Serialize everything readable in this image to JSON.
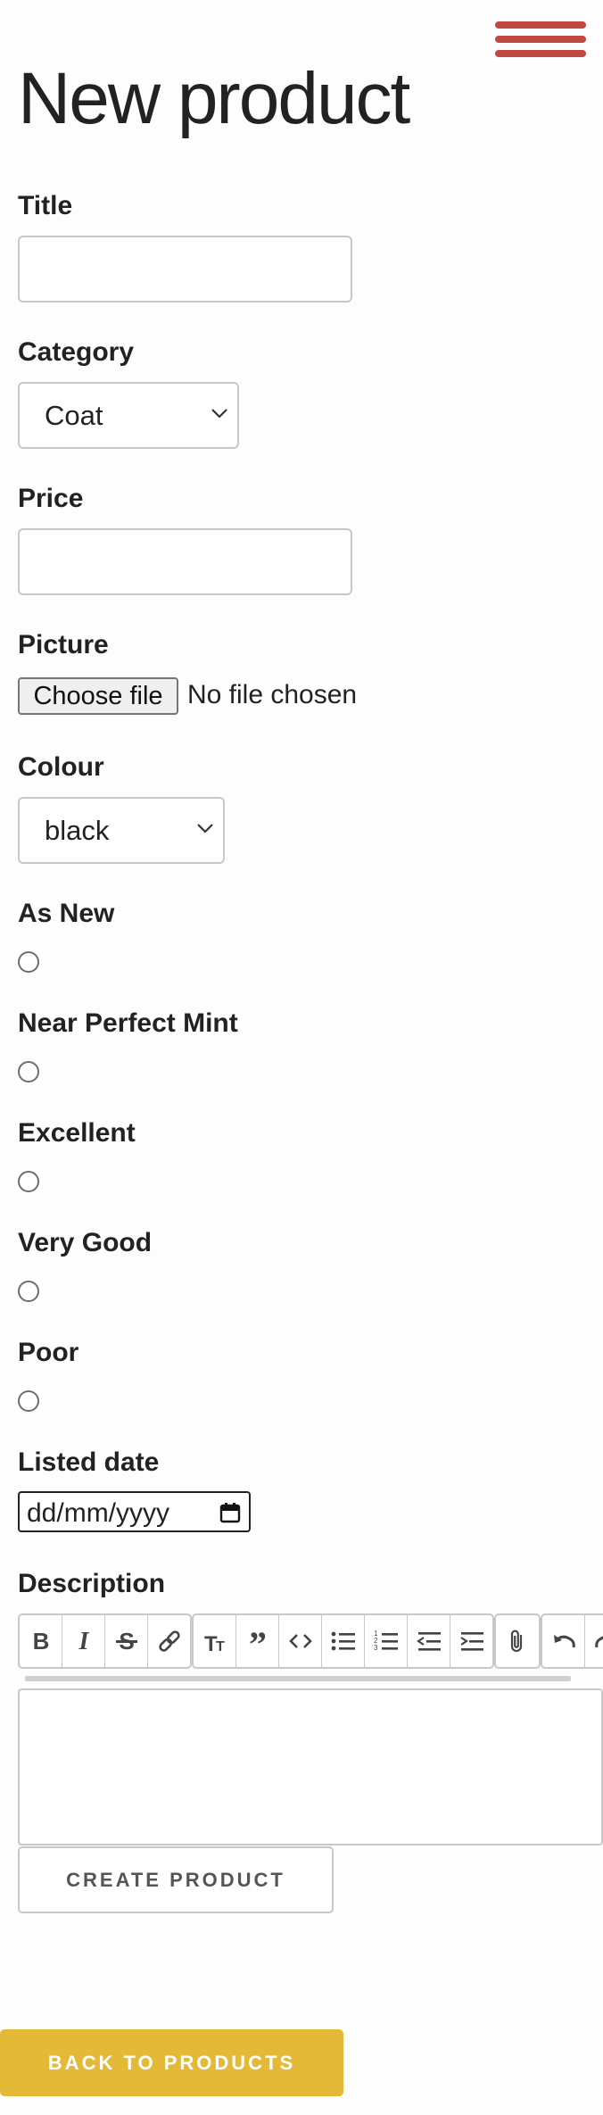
{
  "page": {
    "title": "New product"
  },
  "nav": {
    "menu_icon": "hamburger-icon",
    "accent": "#c0483e"
  },
  "form": {
    "title": {
      "label": "Title",
      "value": ""
    },
    "category": {
      "label": "Category",
      "selected": "Coat"
    },
    "price": {
      "label": "Price",
      "value": ""
    },
    "picture": {
      "label": "Picture",
      "button": "Choose file",
      "status": "No file chosen"
    },
    "colour": {
      "label": "Colour",
      "selected": "black"
    },
    "conditions": [
      {
        "label": "As New",
        "checked": false
      },
      {
        "label": "Near Perfect Mint",
        "checked": false
      },
      {
        "label": "Excellent",
        "checked": false
      },
      {
        "label": "Very Good",
        "checked": false
      },
      {
        "label": "Poor",
        "checked": false
      }
    ],
    "listed_date": {
      "label": "Listed date",
      "placeholder": "dd/mm/yyyy"
    },
    "description": {
      "label": "Description",
      "toolbar": [
        "bold-icon",
        "italic-icon",
        "strikethrough-icon",
        "link-icon",
        "heading-icon",
        "quote-icon",
        "code-icon",
        "bullet-list-icon",
        "numbered-list-icon",
        "outdent-icon",
        "indent-icon",
        "attach-icon",
        "undo-icon",
        "redo-icon"
      ],
      "value": ""
    },
    "submit": "CREATE PRODUCT"
  },
  "back_button": {
    "label": "BACK TO PRODUCTS",
    "color": "#e5b938"
  }
}
